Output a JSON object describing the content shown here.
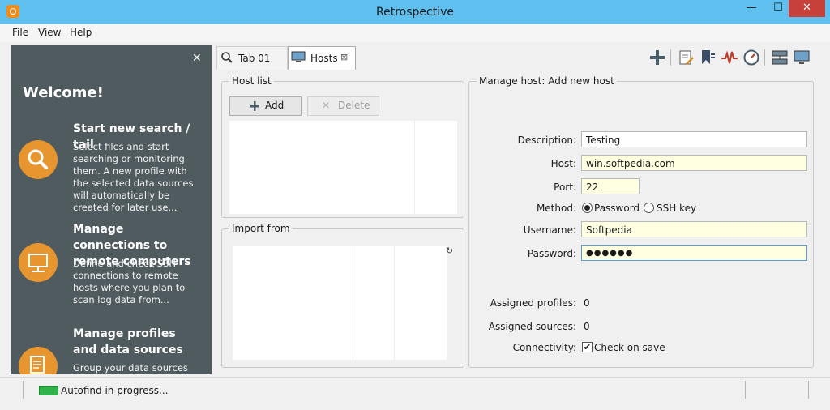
{
  "window": {
    "title": "Retrospective",
    "minimize": "—",
    "maximize": "☐",
    "close": "✕"
  },
  "menu": [
    "File",
    "View",
    "Help"
  ],
  "welcome": {
    "close": "✕",
    "title": "Welcome!",
    "sections": [
      {
        "heading": "Start new search / tail",
        "desc": "Select files and start searching or monitoring them. A new profile with the selected data sources will automatically be created for later use...",
        "icon": "search-icon"
      },
      {
        "heading": "Manage connections to remote computers",
        "desc": "Define and check SSH connections to remote hosts where you plan to scan log data from...",
        "icon": "monitor-icon"
      },
      {
        "heading": "Manage profiles and data sources",
        "desc": "Group your data sources",
        "icon": "document-icon"
      }
    ]
  },
  "tabs": [
    {
      "label": "Tab 01",
      "icon": "search-icon",
      "active": false
    },
    {
      "label": "Hosts",
      "icon": "monitor-icon",
      "active": true,
      "close": "⊠"
    }
  ],
  "toolbar": [
    "add-icon",
    "edit-profile-icon",
    "bookmark-icon",
    "pulse-icon",
    "clock-icon",
    "network-icon",
    "monitor-icon"
  ],
  "hostList": {
    "title": "Host list",
    "add": "Add",
    "delete": "Delete"
  },
  "importFrom": {
    "title": "Import from",
    "refresh": "↻"
  },
  "manageHost": {
    "title": "Manage host: Add new host",
    "descriptionLabel": "Description:",
    "description": "Testing",
    "hostLabel": "Host:",
    "host": "win.softpedia.com",
    "portLabel": "Port:",
    "port": "22",
    "methodLabel": "Method:",
    "methodPassword": "Password",
    "methodSsh": "SSH key",
    "usernameLabel": "Username:",
    "username": "Softpedia",
    "passwordLabel": "Password:",
    "password": "●●●●●●",
    "assignedProfilesLabel": "Assigned profiles:",
    "assignedProfiles": "0",
    "assignedSourcesLabel": "Assigned sources:",
    "assignedSources": "0",
    "connectivityLabel": "Connectivity:",
    "checkOnSave": "Check on save"
  },
  "status": {
    "text": "Autofind in progress..."
  },
  "colors": {
    "titlebar": "#5fbfef",
    "panel": "#505b60",
    "accent": "#e7962f",
    "close": "#c7413a"
  }
}
